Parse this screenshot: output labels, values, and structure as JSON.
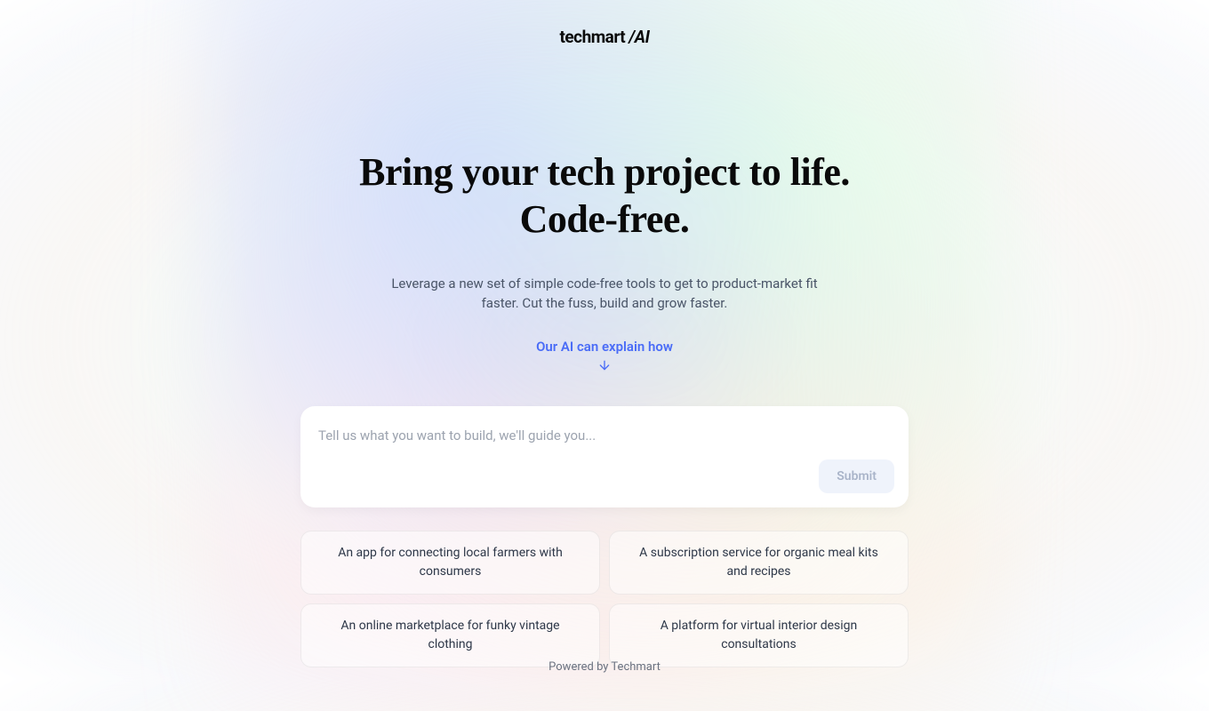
{
  "logo": {
    "main": "techmart",
    "suffix": " /AI"
  },
  "heading": {
    "line1": "Bring your tech project to life.",
    "line2": "Code-free."
  },
  "subheading": "Leverage a new set of simple code-free tools to get to product-market fit faster. Cut the fuss, build and grow faster.",
  "explain_link": "Our AI can explain how",
  "input": {
    "placeholder": "Tell us what you want to build, we'll guide you...",
    "value": ""
  },
  "submit_label": "Submit",
  "suggestions": [
    "An app for connecting local farmers with consumers",
    "A subscription service for organic meal kits and recipes",
    "An online marketplace for funky vintage clothing",
    "A platform for virtual interior design consultations"
  ],
  "footer": "Powered by Techmart"
}
